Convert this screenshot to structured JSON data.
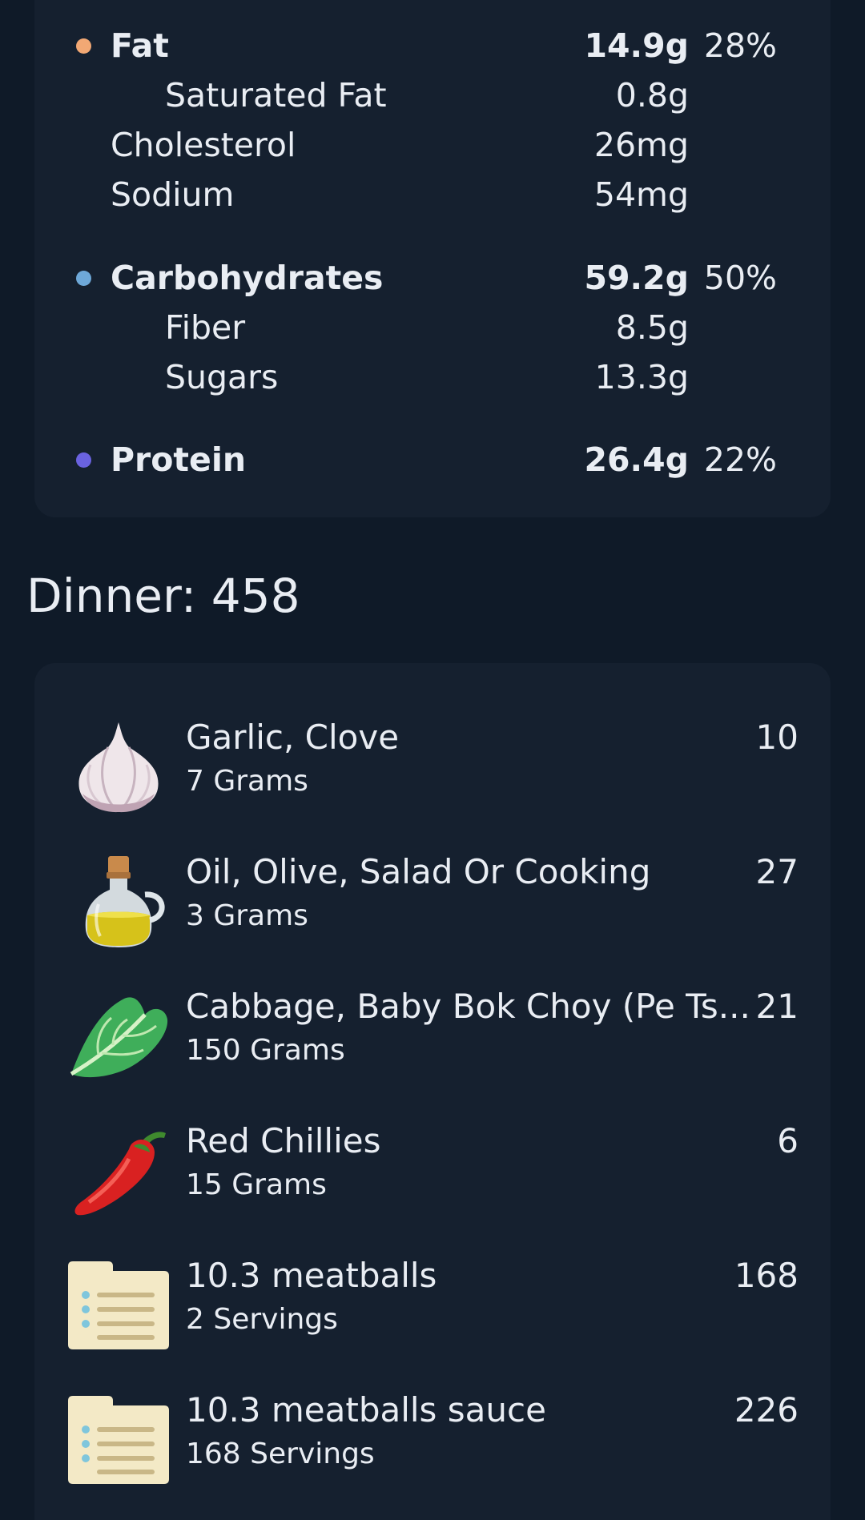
{
  "nutrients": [
    {
      "name": "Fat",
      "amount": "14.9g",
      "percent": "28%",
      "level": "major",
      "dot_color": "#f2a874"
    },
    {
      "name": "Saturated Fat",
      "amount": "0.8g",
      "percent": "",
      "level": "sub"
    },
    {
      "name": "Cholesterol",
      "amount": "26mg",
      "percent": "",
      "level": "detail"
    },
    {
      "name": "Sodium",
      "amount": "54mg",
      "percent": "",
      "level": "detail"
    },
    {
      "name": "Carbohydrates",
      "amount": "59.2g",
      "percent": "50%",
      "level": "major",
      "dot_color": "#6ea8d8"
    },
    {
      "name": "Fiber",
      "amount": "8.5g",
      "percent": "",
      "level": "sub"
    },
    {
      "name": "Sugars",
      "amount": "13.3g",
      "percent": "",
      "level": "sub"
    },
    {
      "name": "Protein",
      "amount": "26.4g",
      "percent": "22%",
      "level": "major",
      "dot_color": "#6a62e0"
    }
  ],
  "meal": {
    "title": "Dinner: 458",
    "items": [
      {
        "name": "Garlic, Clove",
        "quantity": "7 Grams",
        "calories": "10",
        "icon": "garlic-icon"
      },
      {
        "name": "Oil, Olive, Salad Or Cooking",
        "quantity": "3 Grams",
        "calories": "27",
        "icon": "olive-oil-icon"
      },
      {
        "name": "Cabbage, Baby Bok Choy (Pe Ts...",
        "quantity": "150 Grams",
        "calories": "21",
        "icon": "leafy-green-icon"
      },
      {
        "name": "Red Chillies",
        "quantity": "15 Grams",
        "calories": "6",
        "icon": "chili-pepper-icon"
      },
      {
        "name": "10.3 meatballs",
        "quantity": "2 Servings",
        "calories": "168",
        "icon": "recipe-card-icon"
      },
      {
        "name": "10.3 meatballs sauce",
        "quantity": "168 Servings",
        "calories": "226",
        "icon": "recipe-card-icon"
      }
    ]
  },
  "colors": {
    "background": "#0f1a28",
    "card": "#15202f",
    "text": "#e9edf3",
    "fat_dot": "#f2a874",
    "carb_dot": "#6ea8d8",
    "protein_dot": "#6a62e0"
  }
}
